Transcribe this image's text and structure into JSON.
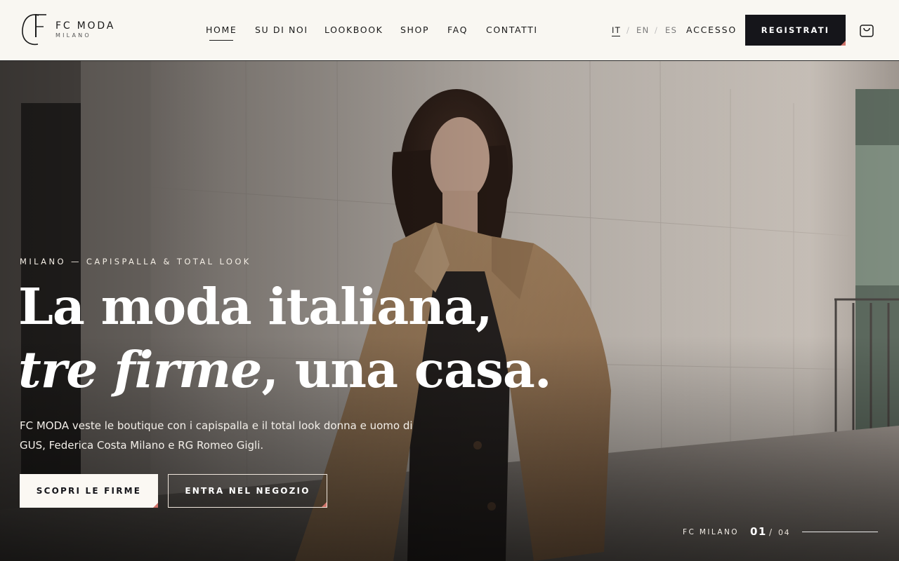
{
  "brand": {
    "monogram": "FC",
    "name": "FC MODA",
    "sub": "MILANO"
  },
  "nav": {
    "home": "HOME",
    "about": "SU DI NOI",
    "lookbook": "LOOKBOOK",
    "shop": "SHOP",
    "faq": "FAQ",
    "contact": "CONTATTI",
    "active": "HOME"
  },
  "languages": {
    "it": "IT",
    "en": "EN",
    "es": "ES",
    "separator": "/",
    "active": "IT"
  },
  "header_actions": {
    "access": "ACCESSO",
    "register": "REGISTRATI",
    "cart_icon": "shopping-bag-icon"
  },
  "hero": {
    "eyebrow": "MILANO — CAPISPALLA & TOTAL LOOK",
    "headline_line1": "La moda italiana,",
    "headline_italic": "tre firme",
    "headline_rest": ", una casa.",
    "description": "FC MODA veste le boutique con i capispalla e il total look donna e uomo di GUS, Federica Costa Milano e RG Romeo Gigli.",
    "primary_cta": "SCOPRI LE FIRME",
    "secondary_cta": "ENTRA NEL NEGOZIO",
    "image": "model-in-beige-trench-coat"
  },
  "slider": {
    "label": "FC MILANO",
    "current": "01",
    "separator": "/",
    "total": "04"
  },
  "colors": {
    "ink": "#15151a",
    "paper": "#f9f7f2",
    "accent": "#d0736a"
  }
}
